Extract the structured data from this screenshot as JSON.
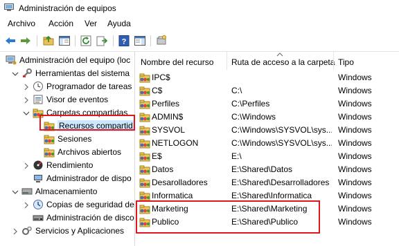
{
  "window": {
    "title": "Administración de equipos",
    "icon": "computer-management-icon"
  },
  "menu": [
    "Archivo",
    "Acción",
    "Ver",
    "Ayuda"
  ],
  "toolbar": {
    "icons": [
      "back-arrow-icon",
      "forward-arrow-icon",
      "up-folder-icon",
      "show-hide-tree-icon",
      "refresh-icon",
      "export-list-icon",
      "help-icon",
      "action-pane-icon",
      "new-share-icon"
    ]
  },
  "tree": {
    "items": [
      {
        "label": "Administración del equipo (loc",
        "icon": "computer-management-icon",
        "level": 0,
        "expander": "none"
      },
      {
        "label": "Herramientas del sistema",
        "icon": "tools-icon",
        "level": 1,
        "expander": "expanded"
      },
      {
        "label": "Programador de tareas",
        "icon": "clock-icon",
        "level": 2,
        "expander": "collapsed"
      },
      {
        "label": "Visor de eventos",
        "icon": "event-viewer-icon",
        "level": 2,
        "expander": "collapsed"
      },
      {
        "label": "Carpetas compartidas",
        "icon": "shared-folder-icon",
        "level": 2,
        "expander": "expanded"
      },
      {
        "label": "Recursos compartid",
        "icon": "shared-folder-icon",
        "level": 3,
        "expander": "none",
        "selected": true
      },
      {
        "label": "Sesiones",
        "icon": "shared-folder-icon",
        "level": 3,
        "expander": "none"
      },
      {
        "label": "Archivos abiertos",
        "icon": "shared-folder-icon",
        "level": 3,
        "expander": "none"
      },
      {
        "label": "Rendimiento",
        "icon": "performance-icon",
        "level": 2,
        "expander": "collapsed"
      },
      {
        "label": "Administrador de dispo",
        "icon": "device-manager-icon",
        "level": 2,
        "expander": "none"
      },
      {
        "label": "Almacenamiento",
        "icon": "storage-icon",
        "level": 1,
        "expander": "expanded"
      },
      {
        "label": "Copias de seguridad de",
        "icon": "backup-icon",
        "level": 2,
        "expander": "collapsed"
      },
      {
        "label": "Administración de disco",
        "icon": "disk-management-icon",
        "level": 2,
        "expander": "none"
      },
      {
        "label": "Servicios y Aplicaciones",
        "icon": "services-icon",
        "level": 1,
        "expander": "collapsed"
      }
    ]
  },
  "list": {
    "columns": [
      "Nombre del recurso",
      "Ruta de acceso a la carpeta",
      "Tipo"
    ],
    "rows": [
      {
        "name": "IPC$",
        "path": "",
        "type": "Windows"
      },
      {
        "name": "C$",
        "path": "C:\\",
        "type": "Windows"
      },
      {
        "name": "Perfiles",
        "path": "C:\\Perfiles",
        "type": "Windows"
      },
      {
        "name": "ADMIN$",
        "path": "C:\\Windows",
        "type": "Windows"
      },
      {
        "name": "SYSVOL",
        "path": "C:\\Windows\\SYSVOL\\sys...",
        "type": "Windows"
      },
      {
        "name": "NETLOGON",
        "path": "C:\\Windows\\SYSVOL\\sys...",
        "type": "Windows"
      },
      {
        "name": "E$",
        "path": "E:\\",
        "type": "Windows"
      },
      {
        "name": "Datos",
        "path": "E:\\Shared\\Datos",
        "type": "Windows"
      },
      {
        "name": "Desarolladores",
        "path": "E:\\Shared\\Desarrolladores",
        "type": "Windows"
      },
      {
        "name": "Informatica",
        "path": "E:\\Shared\\Informatica",
        "type": "Windows"
      },
      {
        "name": "Marketing",
        "path": "E:\\Shared\\Marketing",
        "type": "Windows"
      },
      {
        "name": "Publico",
        "path": "E:\\Shared\\Publico",
        "type": "Windows"
      }
    ]
  },
  "colors": {
    "highlight": "#e0161c",
    "selection": "#cce8ff",
    "accent": "#1e73be"
  }
}
